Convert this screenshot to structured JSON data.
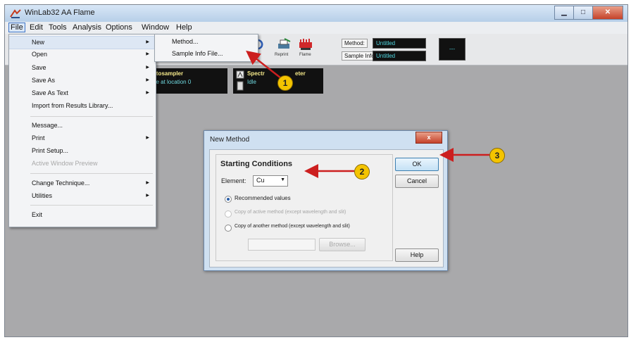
{
  "window": {
    "title": "WinLab32 AA Flame"
  },
  "menubar": {
    "items": [
      "File",
      "Edit",
      "Tools",
      "Analysis",
      "Options",
      "Window",
      "Help"
    ]
  },
  "toolbar": {
    "reprint_label": "Reprint",
    "flame_label": "Flame",
    "partial_label": "ro",
    "method_label": "Method:",
    "method_value": "Untitled",
    "sample_info_label": "Sample Info:",
    "sample_info_value": "Untitled",
    "extra_value": "---"
  },
  "status": {
    "autosampler_title": "utosampler",
    "autosampler_text": "be at location 0",
    "spectrometer_title": "Spectr",
    "spectrometer_title_end": "eter",
    "spectrometer_text": "Idle"
  },
  "file_menu": {
    "items": [
      {
        "label": "New",
        "submenu": true,
        "enabled": true
      },
      {
        "label": "Open",
        "submenu": true,
        "enabled": true
      },
      {
        "label": "Save",
        "submenu": true,
        "enabled": true
      },
      {
        "label": "Save As",
        "submenu": true,
        "enabled": true
      },
      {
        "label": "Save As Text",
        "submenu": true,
        "enabled": true
      },
      {
        "label": "Import from Results Library...",
        "submenu": false,
        "enabled": true
      },
      {
        "label": "Message...",
        "submenu": false,
        "enabled": true
      },
      {
        "label": "Print",
        "submenu": true,
        "enabled": true
      },
      {
        "label": "Print Setup...",
        "submenu": false,
        "enabled": true
      },
      {
        "label": "Active Window Preview",
        "submenu": false,
        "enabled": false
      },
      {
        "label": "Change Technique...",
        "submenu": true,
        "enabled": true
      },
      {
        "label": "Utilities",
        "submenu": true,
        "enabled": true
      },
      {
        "label": "Exit",
        "submenu": false,
        "enabled": true
      }
    ]
  },
  "new_submenu": {
    "items": [
      "Method...",
      "Sample Info File..."
    ]
  },
  "dialog": {
    "title": "New Method",
    "close_label": "x",
    "group_title": "Starting Conditions",
    "element_label": "Element:",
    "element_value": "Cu",
    "option_recommended": "Recommended values",
    "option_copy_active": "Copy of active method (except wavelength and slit)",
    "option_copy_another": "Copy of another method (except wavelength and slit)",
    "browse_label": "Browse...",
    "ok_label": "OK",
    "cancel_label": "Cancel",
    "help_label": "Help"
  },
  "callouts": [
    "1",
    "2",
    "3"
  ],
  "colors": {
    "arrow": "#cc1f1f",
    "callout": "#f4c400",
    "close_button": "#c5422a"
  }
}
